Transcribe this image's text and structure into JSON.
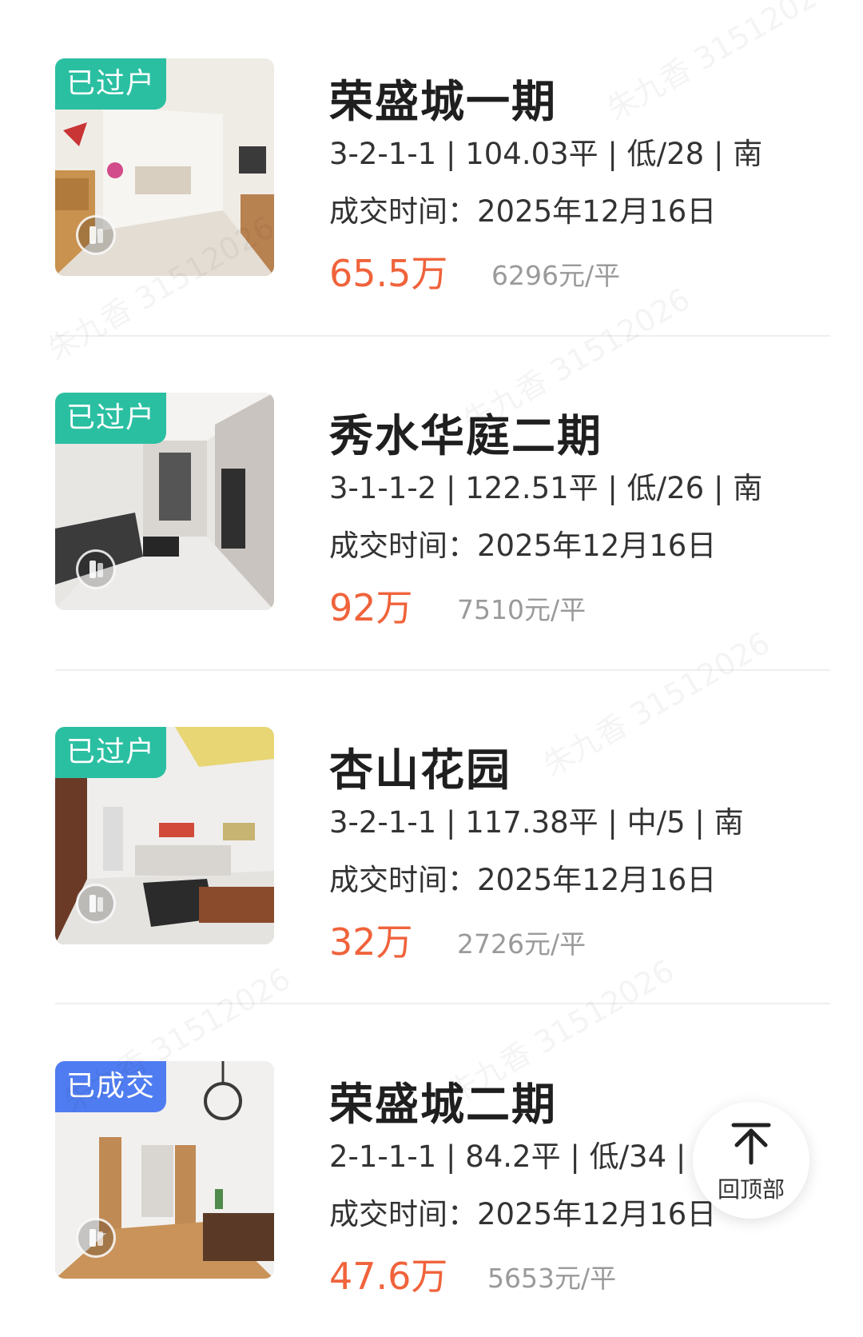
{
  "listings": [
    {
      "tag": "已过户",
      "tag_color": "#2bbfa2",
      "name": "荣盛城一期",
      "specs": "3-2-1-1 | 104.03平 | 低/28 | 南",
      "date": "成交时间：2025年12月16日",
      "price": "65.5万",
      "unit_price": "6296元/平"
    },
    {
      "tag": "已过户",
      "tag_color": "#2bbfa2",
      "name": "秀水华庭二期",
      "specs": "3-1-1-2 | 122.51平 | 低/26 | 南",
      "date": "成交时间：2025年12月16日",
      "price": "92万",
      "unit_price": "7510元/平"
    },
    {
      "tag": "已过户",
      "tag_color": "#2bbfa2",
      "name": "杏山花园",
      "specs": "3-2-1-1 | 117.38平 | 中/5 | 南",
      "date": "成交时间：2025年12月16日",
      "price": "32万",
      "unit_price": "2726元/平"
    },
    {
      "tag": "已成交",
      "tag_color": "#4f7cf0",
      "name": "荣盛城二期",
      "specs": "2-1-1-1 | 84.2平 | 低/34 | 南",
      "date": "成交时间：2025年12月16日",
      "price": "47.6万",
      "unit_price": "5653元/平"
    }
  ],
  "back_to_top": {
    "label": "回顶部",
    "icon": "arrow-up-icon"
  },
  "watermark": "朱九香 31512026"
}
